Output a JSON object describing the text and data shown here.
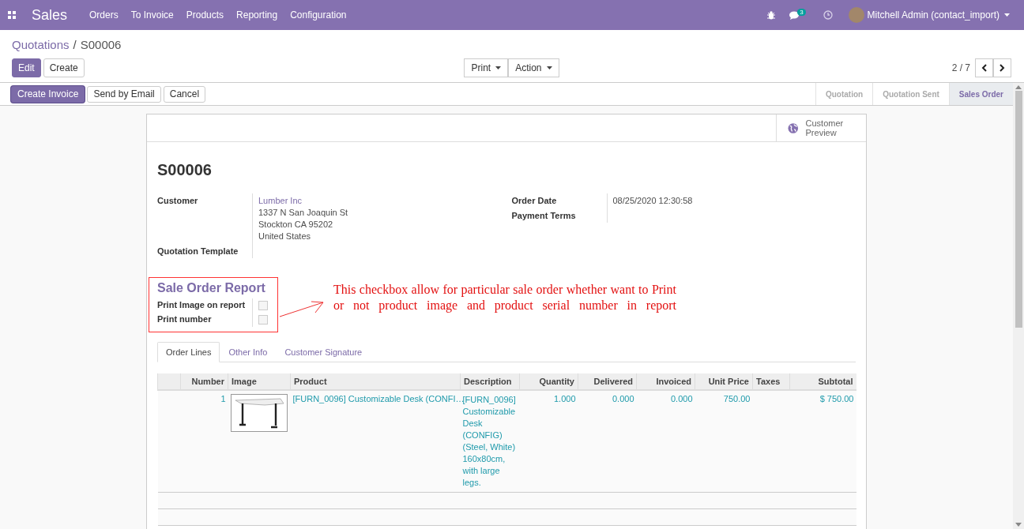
{
  "navbar": {
    "app": "Sales",
    "menu": [
      "Orders",
      "To Invoice",
      "Products",
      "Reporting",
      "Configuration"
    ],
    "message_count": "3",
    "user": "Mitchell Admin (contact_import)"
  },
  "breadcrumb": {
    "parent": "Quotations",
    "separator": "/",
    "current": "S00006"
  },
  "buttons": [
    {
      "label": "Edit",
      "primary": true
    },
    {
      "label": "Create",
      "primary": false
    }
  ],
  "dropdowns": [
    "Print",
    "Action"
  ],
  "pager": "2 / 7",
  "header_buttons": [
    {
      "label": "Create Invoice",
      "primary": true
    },
    {
      "label": "Send by Email",
      "primary": false
    },
    {
      "label": "Cancel",
      "primary": false
    }
  ],
  "status_steps": [
    {
      "label": "Quotation",
      "selected": false
    },
    {
      "label": "Quotation Sent",
      "selected": false
    },
    {
      "label": "Sales Order",
      "selected": true
    }
  ],
  "sheet": {
    "preview_button": "Customer Preview",
    "name": "S00006",
    "left_fields": [
      {
        "label": "Customer",
        "link": "Lumber Inc",
        "lines": [
          "1337 N San Joaquin St",
          "Stockton CA 95202",
          "United States"
        ]
      },
      {
        "label": "Quotation Template"
      }
    ],
    "right_fields": [
      {
        "label": "Order Date",
        "lines": [
          "08/25/2020 12:30:58"
        ]
      },
      {
        "label": "Payment Terms"
      }
    ],
    "report_group": {
      "title": "Sale Order Report",
      "fields": [
        {
          "label": "Print Image on report",
          "checked": false
        },
        {
          "label": "Print number",
          "checked": false
        }
      ]
    },
    "annotation": "This checkbox allow for particular sale order whether want to Print or not product image and product serial number in report",
    "tabs": [
      {
        "label": "Order Lines",
        "selected": true
      },
      {
        "label": "Other Info",
        "selected": false
      },
      {
        "label": "Customer Signature",
        "selected": false
      }
    ],
    "table": {
      "columns": [
        {
          "label": "Number",
          "kind": "number"
        },
        {
          "label": "Image",
          "kind": "image"
        },
        {
          "label": "Product",
          "kind": "text"
        },
        {
          "label": "Description",
          "kind": "text"
        },
        {
          "label": "Quantity",
          "kind": "number"
        },
        {
          "label": "Delivered",
          "kind": "number"
        },
        {
          "label": "Invoiced",
          "kind": "number"
        },
        {
          "label": "Unit Price",
          "kind": "number"
        },
        {
          "label": "Taxes",
          "kind": "text"
        },
        {
          "label": "Subtotal",
          "kind": "number"
        }
      ],
      "rows": [
        {
          "cells": [
            "1",
            null,
            "[FURN_0096] Customizable Desk (CONFI…",
            "[FURN_0096] Customizable Desk (CONFIG) (Steel, White) 160x80cm, with large legs.",
            "1.000",
            "0.000",
            "0.000",
            "750.00",
            null,
            "$ 750.00"
          ]
        }
      ]
    }
  }
}
